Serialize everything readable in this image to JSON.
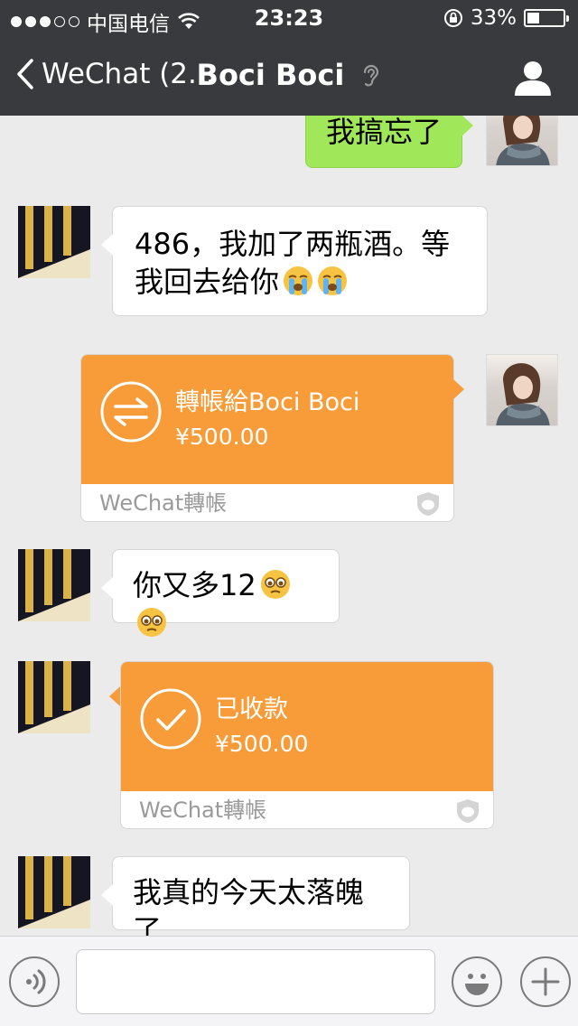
{
  "status": {
    "carrier": "中国电信",
    "time": "23:23",
    "battery": "33%",
    "battery_level": 0.33
  },
  "nav": {
    "back_label": "WeChat (2...",
    "title": "Boci Boci"
  },
  "messages": {
    "m1": {
      "text": "我搞忘了"
    },
    "m2": {
      "line1": "486，我加了两瓶酒。等",
      "line2": "我回去给你"
    },
    "m3": {
      "label": "轉帳給Boci Boci",
      "amount": "¥500.00",
      "footer": "WeChat轉帳"
    },
    "m4": {
      "text": "你又多12"
    },
    "m5": {
      "label": "已收款",
      "amount": "¥500.00",
      "footer": "WeChat轉帳"
    },
    "m6": {
      "text": "我真的今天太落魄了"
    }
  },
  "colors": {
    "bar": "#393a3e",
    "sent_bubble": "#a0e75a",
    "transfer": "#f79c38",
    "background": "#ebebeb"
  }
}
